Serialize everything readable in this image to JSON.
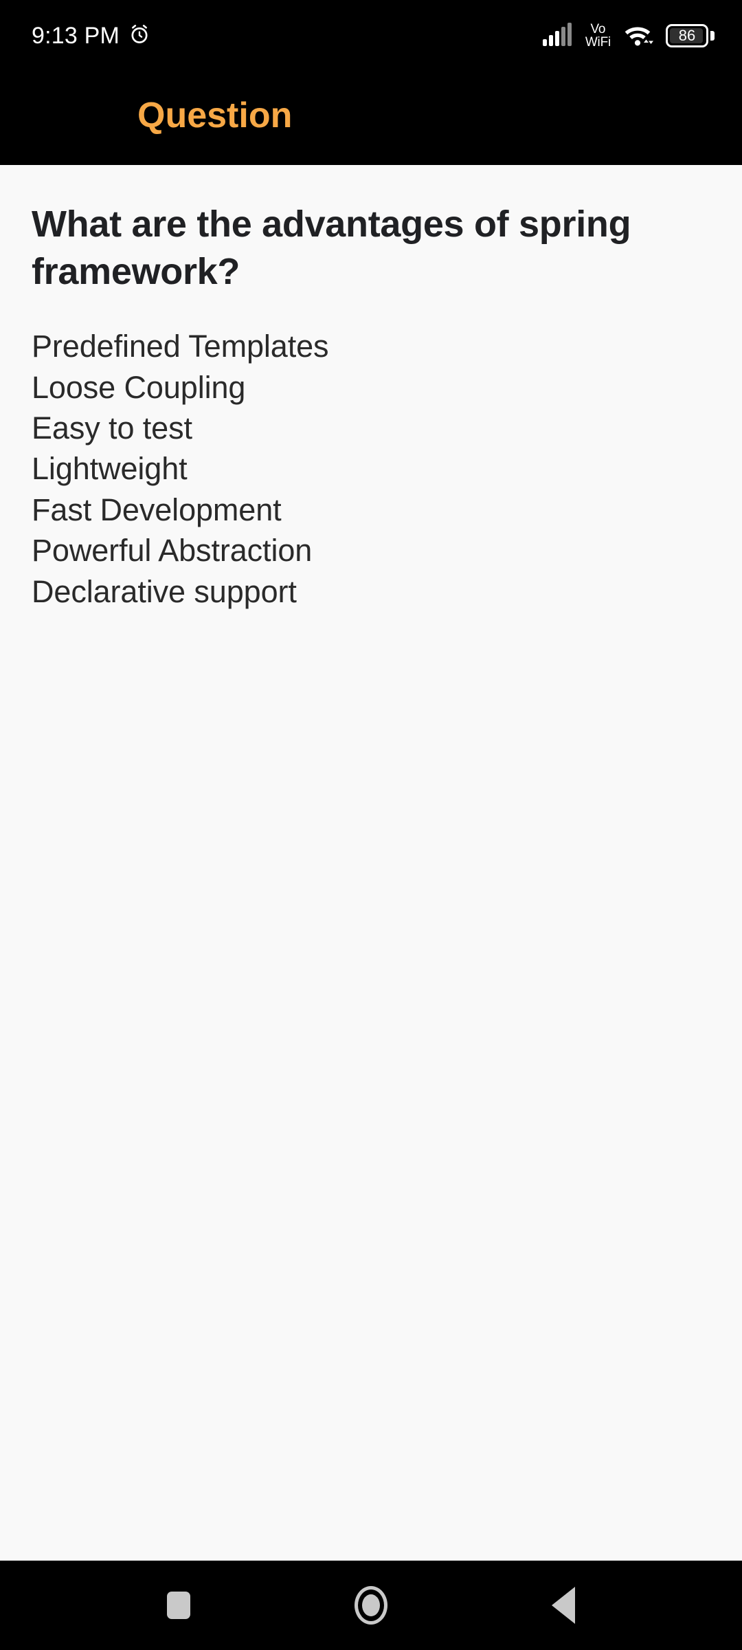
{
  "status_bar": {
    "time": "9:13 PM",
    "alarm_icon": "alarm-clock-icon",
    "signal_icon": "cellular-signal-icon",
    "network_label_line1": "Vo",
    "network_label_line2": "WiFi",
    "wifi_icon": "wifi-icon",
    "battery_level": "86",
    "battery_icon": "battery-icon"
  },
  "app_bar": {
    "title": "Question",
    "title_color": "#f7a846",
    "background_color": "#000000"
  },
  "content": {
    "background_color": "#f9f9f9",
    "question": "What are the advantages of spring framework?",
    "answers": [
      "Predefined Templates",
      "Loose Coupling",
      "Easy to test",
      "Lightweight",
      "Fast Development",
      "Powerful Abstraction",
      "Declarative support"
    ]
  },
  "nav_bar": {
    "recents_icon": "recents-square-icon",
    "home_icon": "home-circle-icon",
    "back_icon": "back-triangle-icon"
  }
}
